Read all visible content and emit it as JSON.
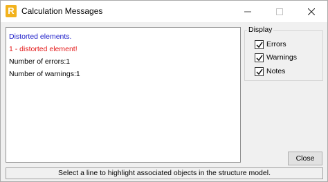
{
  "window": {
    "title": "Calculation Messages",
    "app_icon_letter": "R",
    "app_icon_color": "#f2b21d"
  },
  "messages": [
    {
      "text": "Distorted elements.",
      "color": "#1a1ac8"
    },
    {
      "text": "1 - distorted element!",
      "color": "#e41a1a"
    },
    {
      "text": "Number of errors:1",
      "color": "#000000"
    },
    {
      "text": "Number of warnings:1",
      "color": "#000000"
    }
  ],
  "display": {
    "legend": "Display",
    "options": [
      {
        "label": "Errors",
        "checked": true
      },
      {
        "label": "Warnings",
        "checked": true
      },
      {
        "label": "Notes",
        "checked": true
      }
    ]
  },
  "buttons": {
    "close_label": "Close"
  },
  "status": {
    "text": "Select a line to highlight associated objects in the structure model."
  }
}
